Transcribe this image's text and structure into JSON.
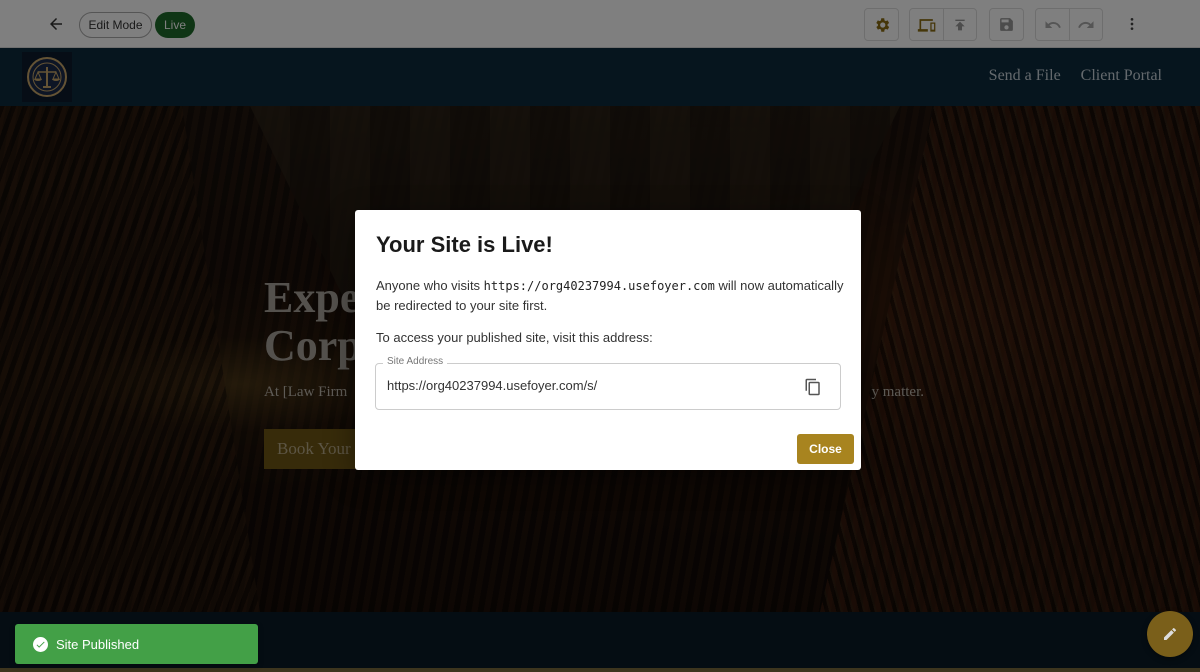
{
  "toolbar": {
    "back_icon": "arrow-left-icon",
    "edit_mode_label": "Edit Mode",
    "live_label": "Live",
    "buttons": [
      {
        "icon": "gear-icon",
        "label": "Settings"
      },
      {
        "icon": "devices-icon",
        "label": "Preview devices"
      },
      {
        "icon": "publish-icon",
        "label": "Publish"
      },
      {
        "icon": "save-icon",
        "label": "Save"
      },
      {
        "icon": "undo-icon",
        "label": "Undo"
      },
      {
        "icon": "redo-icon",
        "label": "Redo"
      },
      {
        "icon": "more-vertical-icon",
        "label": "More"
      }
    ],
    "accent_color": "#8a6d12",
    "live_color": "#1f6b2a"
  },
  "site": {
    "logo_icon": "scales-of-justice-icon",
    "nav_links": [
      "Send a File",
      "Client Portal"
    ],
    "hero": {
      "title_line1": "Expe",
      "title_line2": "Corp",
      "subtitle_left": "At [Law Firm",
      "subtitle_right": "y matter.",
      "cta_label": "Book Your"
    }
  },
  "modal": {
    "title": "Your Site is Live!",
    "p1_before": "Anyone who visits ",
    "p1_url": "https://org40237994.usefoyer.com",
    "p1_after": " will now automatically be redirected to your site first.",
    "p2": "To access your published site, visit this address:",
    "field_label": "Site Address",
    "field_value": "https://org40237994.usefoyer.com/s/",
    "copy_icon": "copy-icon",
    "close_label": "Close",
    "close_color": "#a8841f"
  },
  "toast": {
    "icon": "check-circle-icon",
    "text": "Site Published",
    "color": "#43a047"
  },
  "fab": {
    "icon": "pencil-icon",
    "color": "#7a5f1a"
  }
}
